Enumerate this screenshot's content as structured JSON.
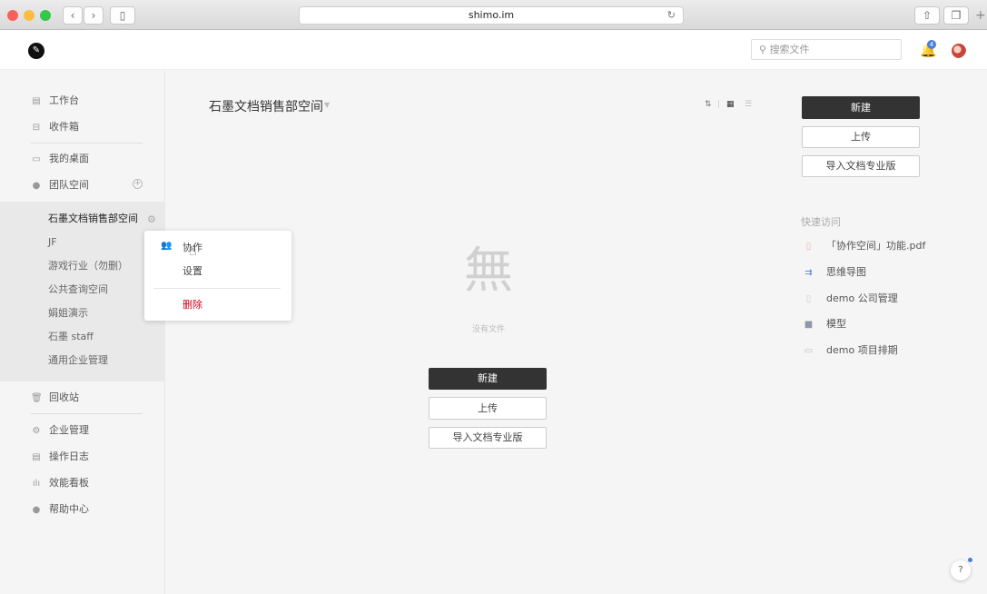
{
  "browser": {
    "url": "shimo.im",
    "reload_icon": "reload-icon",
    "back_icon": "chevron-left-icon",
    "forward_icon": "chevron-right-icon",
    "share_icon": "share-icon",
    "tabs_icon": "tabs-icon",
    "newtab_icon": "plus-icon",
    "colors": {
      "close": "#fc605c",
      "minimize": "#fdbc40",
      "zoom": "#34c84a"
    }
  },
  "header": {
    "search_placeholder": "搜索文件",
    "notification_count": "4"
  },
  "sidebar": {
    "items": [
      {
        "label": "工作台",
        "icon": "workbench-icon"
      },
      {
        "label": "收件箱",
        "icon": "inbox-icon"
      },
      {
        "label": "我的桌面",
        "icon": "desktop-icon"
      },
      {
        "label": "团队空间",
        "icon": "team-icon"
      }
    ],
    "team_spaces": [
      "石墨文档销售部空间",
      "JF",
      "游戏行业（勿删）",
      "公共查询空间",
      "娟姐演示",
      "石墨 staff",
      "通用企业管理"
    ],
    "bottom_items": [
      {
        "label": "回收站",
        "icon": "trash-icon"
      },
      {
        "label": "企业管理",
        "icon": "gear-icon"
      },
      {
        "label": "操作日志",
        "icon": "log-icon"
      },
      {
        "label": "效能看板",
        "icon": "chart-icon"
      },
      {
        "label": "帮助中心",
        "icon": "help-pin-icon"
      }
    ]
  },
  "context_menu": {
    "collaborate": "协作",
    "settings": "设置",
    "delete": "删除",
    "delete_color": "#d0021b"
  },
  "main": {
    "title": "石墨文档销售部空间",
    "empty_glyph": "無",
    "empty_text": "没有文件",
    "new_label": "新建",
    "upload_label": "上传",
    "import_label": "导入文档专业版"
  },
  "quick_access": {
    "title": "快速访问",
    "items": [
      {
        "label": "「协作空间」功能.pdf",
        "icon": "pdf-icon"
      },
      {
        "label": "思维导图",
        "icon": "mindmap-icon"
      },
      {
        "label": "demo 公司管理",
        "icon": "doc-icon"
      },
      {
        "label": "模型",
        "icon": "folder-icon"
      },
      {
        "label": "demo 项目排期",
        "icon": "sheet-icon"
      }
    ]
  },
  "help_label": "?"
}
